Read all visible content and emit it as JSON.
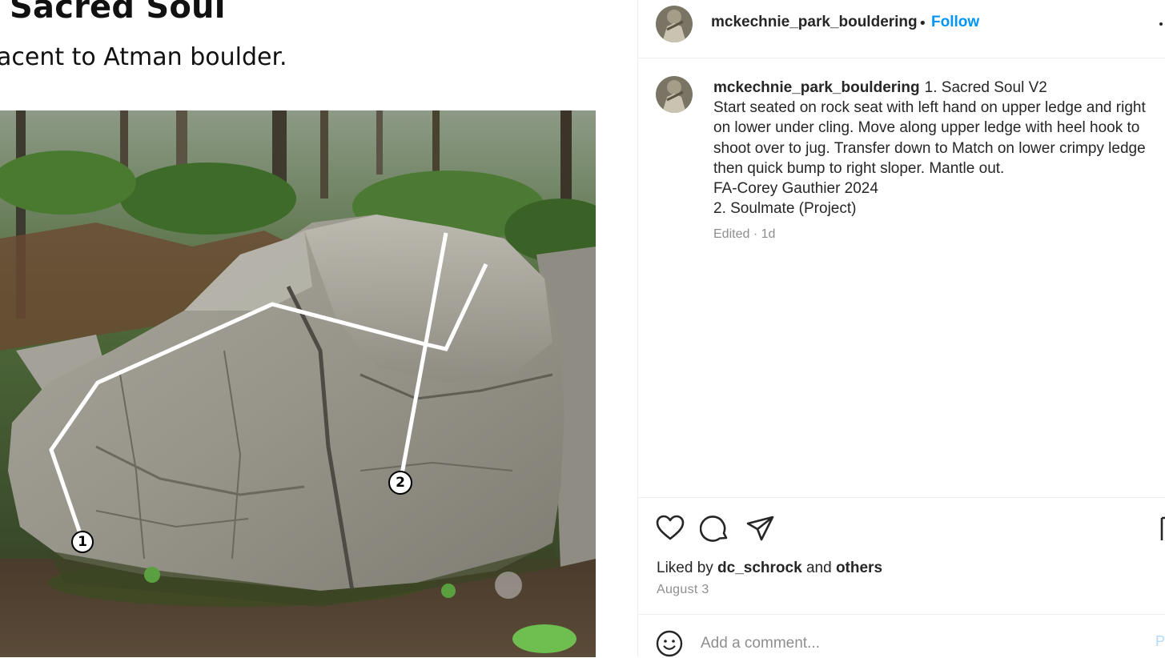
{
  "media": {
    "title": "Sacred Soul",
    "subtitle": "acent to Atman boulder.",
    "route_markers": [
      "1",
      "2"
    ]
  },
  "post": {
    "header": {
      "username": "mckechnie_park_bouldering",
      "separator": "•",
      "follow_label": "Follow"
    },
    "caption": {
      "username": "mckechnie_park_bouldering",
      "first_line": "1. Sacred Soul V2",
      "lines": [
        "Start seated on rock seat with left hand on upper ledge and right",
        "on lower under cling. Move along upper ledge with heel hook to",
        "shoot over to jug. Transfer down to Match on lower crimpy ledge",
        "then quick bump to right sloper. Mantle out.",
        "FA-Corey Gauthier 2024",
        "2. Soulmate (Project)"
      ],
      "edited": "Edited",
      "time_separator": " · ",
      "time_ago": "1d"
    },
    "likes": {
      "prefix": "Liked by ",
      "user": "dc_schrock",
      "middle": " and ",
      "others": "others"
    },
    "date": "August 3",
    "comment": {
      "placeholder": "Add a comment...",
      "post_label": "Po"
    },
    "icons": {
      "like": "heart-icon",
      "comment": "speech-bubble-icon",
      "share": "paper-plane-icon",
      "save": "bookmark-icon",
      "emoji": "smiley-icon",
      "more": "more-dots-icon"
    },
    "colors": {
      "link": "#0095f6",
      "text": "#262626",
      "muted": "#8e8e8e"
    }
  }
}
